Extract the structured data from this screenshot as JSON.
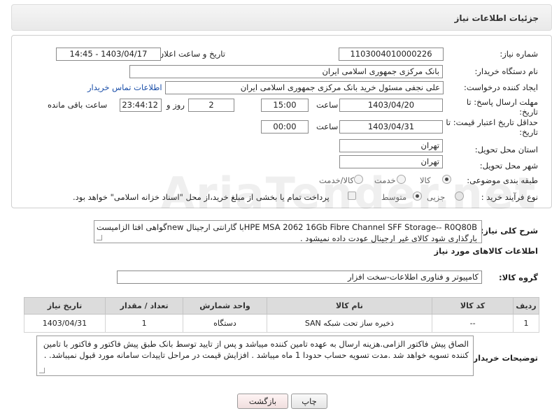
{
  "header": {
    "title": "جزئیات اطلاعات نیاز"
  },
  "form": {
    "need_number_label": "شماره نیاز:",
    "need_number": "1103004010000226",
    "announce_label": "تاریخ و ساعت اعلان عمومی:",
    "announce_value": "1403/04/17 - 14:45",
    "buyer_org_label": "نام دستگاه خریدار:",
    "buyer_org": "بانک مرکزی جمهوری اسلامی ایران",
    "requester_label": "ایجاد کننده درخواست:",
    "requester": "علی  نجفی مسئول خرید بانک مرکزی جمهوری اسلامی ایران",
    "contact_link": "اطلاعات تماس خریدار",
    "reply_deadline_label": "مهلت ارسال پاسخ: تا تاریخ:",
    "reply_date": "1403/04/20",
    "time_label": "ساعت",
    "reply_time": "15:00",
    "days_value": "2",
    "days_label": "روز و",
    "remaining_time": "23:44:12",
    "remaining_label": "ساعت باقی مانده",
    "validity_label": "حداقل تاریخ اعتبار قیمت: تا تاریخ:",
    "validity_date": "1403/04/31",
    "validity_time": "00:00",
    "province_label": "استان محل تحویل:",
    "province": "تهران",
    "city_label": "شهر محل تحویل:",
    "city": "تهران",
    "category_label": "طبقه بندی موضوعی:",
    "category_options": [
      "کالا",
      "خدمت",
      "کالا/خدمت"
    ],
    "process_label": "نوع فرآیند خرید :",
    "process_options": [
      "جزیی",
      "متوسط"
    ],
    "payment_note": "پرداخت تمام یا بخشی از مبلغ خرید،از محل \"اسناد خزانه اسلامی\" خواهد بود."
  },
  "description": {
    "label": "شرح کلی نیاز:",
    "text_line1": "HPE MSA 2062 16Gb Fibre Channel SFF Storage-- R0Q80Bبا گارانتی ارجینال newگواهی افتا الزامیست",
    "text_line2": "بارگذاری شود کالای غیر ارجینال عودت داده نمیشود ."
  },
  "goods_section": {
    "title": "اطلاعات کالاهای مورد نیاز",
    "group_label": "گروه کالا:",
    "group_value": "کامپیوتر و فناوری اطلاعات-سخت افزار"
  },
  "table": {
    "headers": [
      "ردیف",
      "کد کالا",
      "نام کالا",
      "واحد شمارش",
      "تعداد / مقدار",
      "تاریخ نیاز"
    ],
    "rows": [
      [
        "1",
        "--",
        "ذخیره ساز تحت شبکه SAN",
        "دستگاه",
        "1",
        "1403/04/31"
      ]
    ]
  },
  "buyer_notes": {
    "label": "توضیحات خریدار:",
    "text": "الصاق پیش فاکتور الزامی.هزینه ارسال به عهده تامین کننده میباشد و پس از تایید توسط بانک طبق پیش فاکتور و فاکتور با تامین کننده تسویه خواهد شد .مدت تسویه حساب حدودا 1 ماه میباشد . افزایش قیمت در مراحل تاییدات سامانه مورد قبول نمیباشد.  ."
  },
  "buttons": {
    "print": "چاپ",
    "back": "بازگشت"
  },
  "colors": {
    "link": "#1a4ea8",
    "header_bg": "#ececec",
    "table_header_bg": "#dcdcdc"
  }
}
